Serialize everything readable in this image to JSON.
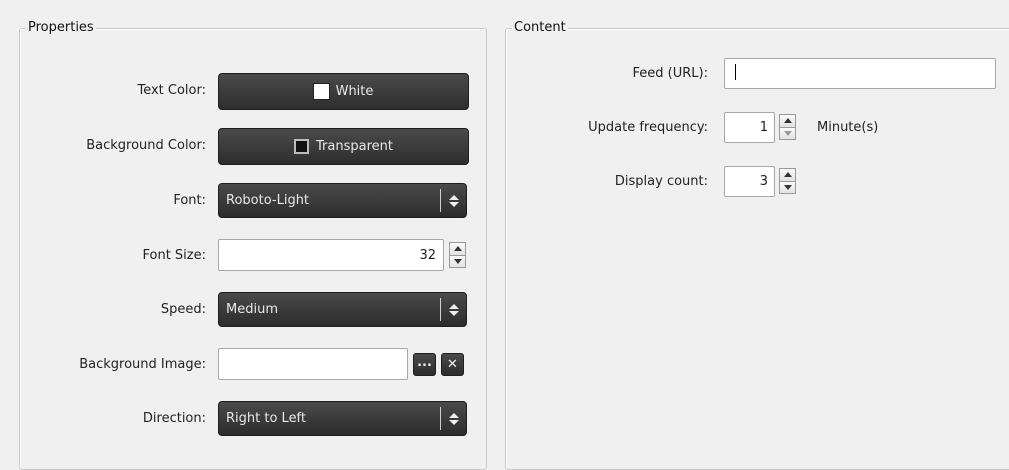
{
  "properties": {
    "title": "Properties",
    "text_color": {
      "label": "Text Color:",
      "value": "White"
    },
    "background_color": {
      "label": "Background Color:",
      "value": "Transparent"
    },
    "font": {
      "label": "Font:",
      "value": "Roboto-Light"
    },
    "font_size": {
      "label": "Font Size:",
      "value": "32"
    },
    "speed": {
      "label": "Speed:",
      "value": "Medium"
    },
    "background_image": {
      "label": "Background Image:",
      "value": "",
      "browse_label": "...",
      "clear_label": "✕"
    },
    "direction": {
      "label": "Direction:",
      "value": "Right to Left"
    }
  },
  "content": {
    "title": "Content",
    "feed_url": {
      "label": "Feed (URL):",
      "value": ""
    },
    "update_frequency": {
      "label": "Update frequency:",
      "value": "1",
      "unit": "Minute(s)"
    },
    "display_count": {
      "label": "Display count:",
      "value": "3"
    }
  },
  "colors": {
    "dark_control": "#333333",
    "panel_bg": "#f0f0f0"
  }
}
